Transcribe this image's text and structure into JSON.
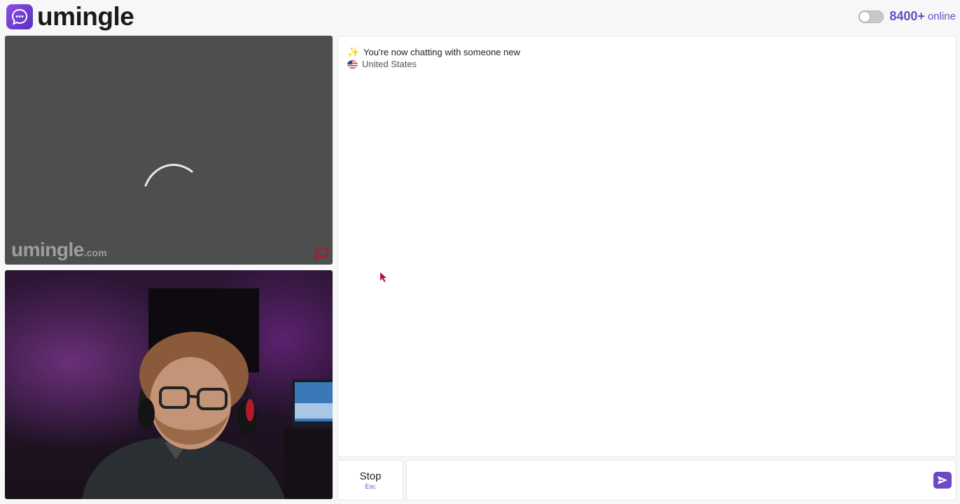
{
  "brand": {
    "name": "umingle",
    "watermark_main": "umingle",
    "watermark_suffix": ".com",
    "accent_color": "#6a4bc4"
  },
  "header": {
    "online_count": "8400+",
    "online_label": "online",
    "toggle_state": "off"
  },
  "chat": {
    "system_message": "You're now chatting with someone new",
    "partner_country": "United States",
    "messages": []
  },
  "controls": {
    "stop_label": "Stop",
    "stop_shortcut": "Esc",
    "message_value": "",
    "send_icon": "send-icon"
  },
  "remote_video": {
    "status": "loading"
  }
}
